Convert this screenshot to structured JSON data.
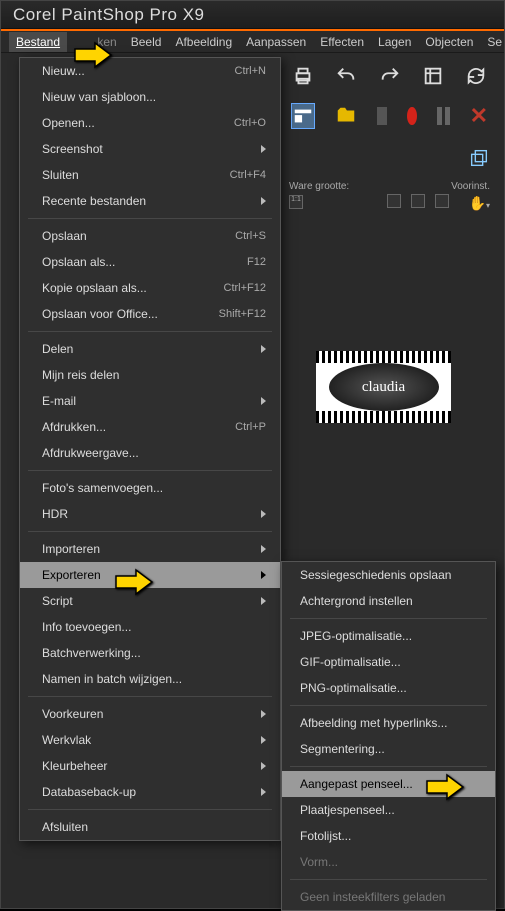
{
  "window": {
    "title": "Corel PaintShop Pro X9"
  },
  "menubar": {
    "items": [
      {
        "label": "Bestand",
        "accel": "B"
      },
      {
        "label": "Bewerken",
        "accel": "e"
      },
      {
        "label": "Beeld",
        "accel": "B"
      },
      {
        "label": "Afbeelding",
        "accel": "A"
      },
      {
        "label": "Aanpassen",
        "accel": "A"
      },
      {
        "label": "Effecten",
        "accel": "E"
      },
      {
        "label": "Lagen",
        "accel": "L"
      },
      {
        "label": "Objecten",
        "accel": "O"
      },
      {
        "label": "Se",
        "accel": "S"
      }
    ]
  },
  "file_menu": {
    "new": "Nieuw...",
    "new_sc": "Ctrl+N",
    "new_template": "Nieuw van sjabloon...",
    "open": "Openen...",
    "open_sc": "Ctrl+O",
    "screenshot": "Screenshot",
    "close": "Sluiten",
    "close_sc": "Ctrl+F4",
    "recent": "Recente bestanden",
    "save": "Opslaan",
    "save_sc": "Ctrl+S",
    "save_as": "Opslaan als...",
    "save_as_sc": "F12",
    "copy_save": "Kopie opslaan als...",
    "copy_save_sc": "Ctrl+F12",
    "save_office": "Opslaan voor Office...",
    "save_office_sc": "Shift+F12",
    "share": "Delen",
    "share_trip": "Mijn reis delen",
    "email": "E-mail",
    "print": "Afdrukken...",
    "print_sc": "Ctrl+P",
    "print_preview": "Afdrukweergave...",
    "merge": "Foto's samenvoegen...",
    "hdr": "HDR",
    "import": "Importeren",
    "export": "Exporteren",
    "script": "Script",
    "info": "Info toevoegen...",
    "batch": "Batchverwerking...",
    "rename_batch": "Namen in batch wijzigen...",
    "prefs": "Voorkeuren",
    "workspace": "Werkvlak",
    "color_mgmt": "Kleurbeheer",
    "db_backup": "Databaseback-up",
    "exit": "Afsluiten"
  },
  "export_submenu": {
    "session": "Sessiegeschiedenis opslaan",
    "background": "Achtergrond instellen",
    "jpeg": "JPEG-optimalisatie...",
    "gif": "GIF-optimalisatie...",
    "png": "PNG-optimalisatie...",
    "hyperlinks": "Afbeelding met hyperlinks...",
    "segment": "Segmentering...",
    "custom_brush": "Aangepast penseel...",
    "picture_brush": "Plaatjespenseel...",
    "photo_list": "Fotolijst...",
    "shape": "Vorm...",
    "no_plugins": "Geen insteekfilters geladen"
  },
  "properties": {
    "ware_grootte": "Ware grootte:",
    "voorinst": "Voorinst.",
    "one_to_one": "1:1"
  },
  "logo": {
    "text": "claudia"
  }
}
